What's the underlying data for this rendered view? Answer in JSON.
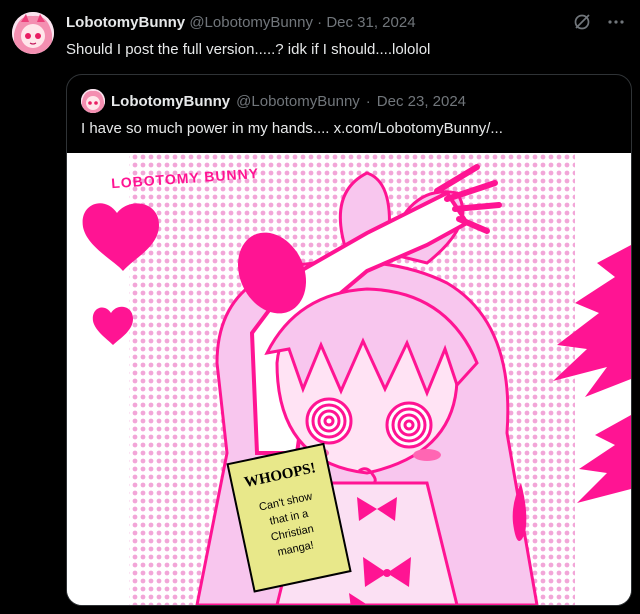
{
  "post": {
    "display_name": "LobotomyBunny",
    "handle": "@LobotomyBunny",
    "separator": "·",
    "date": "Dec 31, 2024",
    "text": "Should I post the full version.....? idk if I should....lololol",
    "icons": [
      "grok-icon",
      "more-icon"
    ]
  },
  "quote": {
    "display_name": "LobotomyBunny",
    "handle": "@LobotomyBunny",
    "separator": "·",
    "date": "Dec 23, 2024",
    "text": "I have so much power in my hands....  x.com/LobotomyBunny/...",
    "image": {
      "logo_text": "LOBOTOMY BUNNY",
      "sign_title": "WHOOPS!",
      "sign_lines": [
        "Can't show",
        "that in a",
        "Christian",
        "manga!"
      ],
      "colors": {
        "pink": "#ff1493",
        "light_pink": "#f8c6ee",
        "dots": "#f2a6d8",
        "sign": "#e8e88a"
      }
    }
  }
}
